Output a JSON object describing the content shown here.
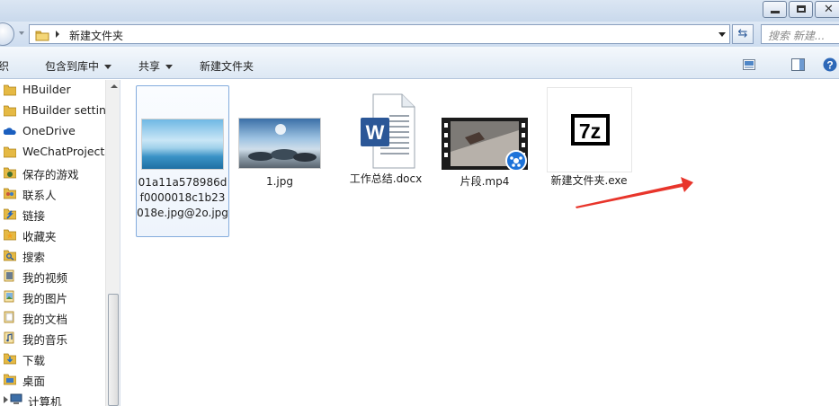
{
  "address": {
    "path": "新建文件夹",
    "search_placeholder": "搜索 新建..."
  },
  "toolbar": {
    "organize_fragment": "织",
    "include_library": "包含到库中",
    "share": "共享",
    "new_folder": "新建文件夹"
  },
  "sidebar": {
    "items": [
      {
        "label": "HBuilder",
        "icon": "folder-icon"
      },
      {
        "label": "HBuilder setting",
        "icon": "folder-icon"
      },
      {
        "label": "OneDrive",
        "icon": "cloud-icon"
      },
      {
        "label": "WeChatProjects",
        "icon": "folder-icon"
      },
      {
        "label": "保存的游戏",
        "icon": "games-icon"
      },
      {
        "label": "联系人",
        "icon": "contacts-icon"
      },
      {
        "label": "链接",
        "icon": "links-icon"
      },
      {
        "label": "收藏夹",
        "icon": "favorites-icon"
      },
      {
        "label": "搜索",
        "icon": "search-folder-icon"
      },
      {
        "label": "我的视频",
        "icon": "videos-icon"
      },
      {
        "label": "我的图片",
        "icon": "pictures-icon"
      },
      {
        "label": "我的文档",
        "icon": "documents-icon"
      },
      {
        "label": "我的音乐",
        "icon": "music-icon"
      },
      {
        "label": "下载",
        "icon": "downloads-icon"
      },
      {
        "label": "桌面",
        "icon": "desktop-icon"
      },
      {
        "label": "计算机",
        "icon": "computer-icon"
      }
    ]
  },
  "files": [
    {
      "name": "01a11a578986df0000018c1b23018e.jpg@2o.jpg",
      "type": "image",
      "selected": true
    },
    {
      "name": "1.jpg",
      "type": "image"
    },
    {
      "name": "工作总结.docx",
      "type": "word"
    },
    {
      "name": "片段.mp4",
      "type": "video"
    },
    {
      "name": "新建文件夹.exe",
      "type": "7z"
    }
  ],
  "colors": {
    "selection_border": "#84acdd",
    "annotation_arrow": "#e8352b",
    "word_blue": "#2b5797"
  }
}
